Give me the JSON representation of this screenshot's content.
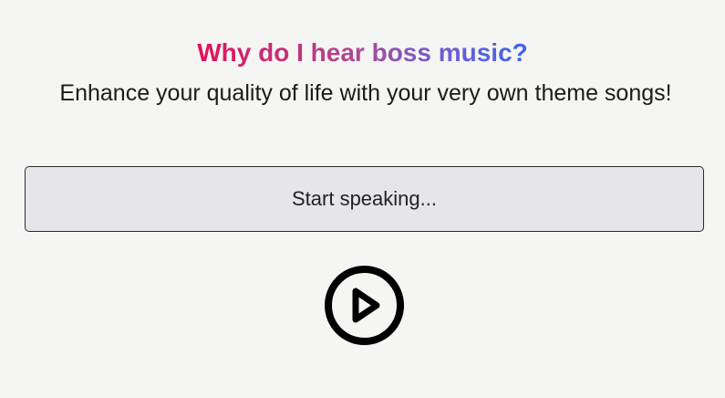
{
  "header": {
    "title": "Why do I hear boss music?",
    "subtitle": "Enhance your quality of life with your very own theme songs!"
  },
  "speech": {
    "placeholder": "Start speaking..."
  },
  "controls": {
    "play_icon": "play-circle-icon"
  },
  "colors": {
    "title_gradient_start": "#e4105a",
    "title_gradient_end": "#3b64f2",
    "background": "#f5f5f3",
    "input_background": "#e6e6ea"
  }
}
